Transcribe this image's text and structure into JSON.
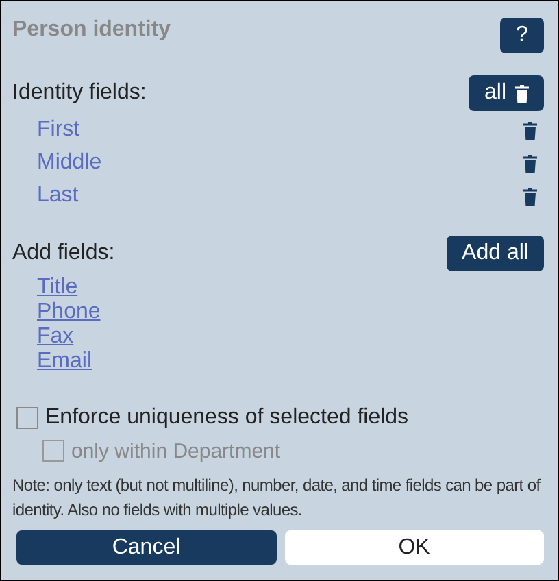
{
  "dialog": {
    "title": "Person identity",
    "help_button": "?"
  },
  "identity_fields": {
    "label": "Identity fields:",
    "remove_all_button": "all",
    "items": [
      {
        "name": "First"
      },
      {
        "name": "Middle"
      },
      {
        "name": "Last"
      }
    ]
  },
  "add_fields": {
    "label": "Add fields:",
    "add_all_button": "Add all",
    "items": [
      {
        "name": "Title"
      },
      {
        "name": "Phone"
      },
      {
        "name": "Fax"
      },
      {
        "name": "Email"
      }
    ]
  },
  "options": [
    {
      "label": "Enforce uniqueness of selected fields",
      "checked": false,
      "disabled": false,
      "indented": false
    },
    {
      "label": "only within Department",
      "checked": false,
      "disabled": true,
      "indented": true
    }
  ],
  "note": "Note: only text (but not multiline), number, date, and time fields can be part of identity. Also no fields with multiple values.",
  "buttons": [
    {
      "label": "Cancel",
      "kind": "secondary"
    },
    {
      "label": "OK",
      "kind": "primary"
    }
  ]
}
